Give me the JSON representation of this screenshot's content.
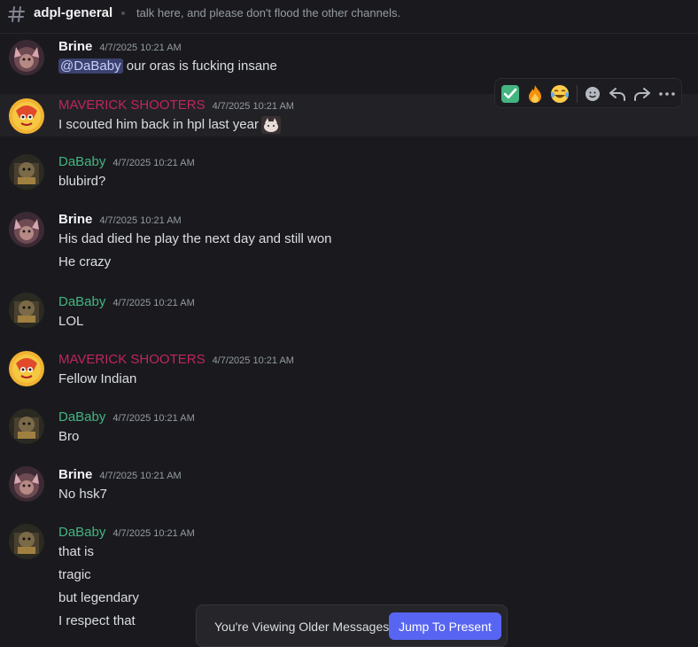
{
  "header": {
    "icon": "hash-icon",
    "channel_name": "adpl-general",
    "topic": "talk here, and please don't flood the other channels."
  },
  "messages": [
    {
      "author": "Brine",
      "timestamp": "4/7/2025 10:21 AM",
      "mention": "@DaBaby",
      "lines": [
        " our oras is fucking insane"
      ]
    },
    {
      "author": "MAVERICK SHOOTERS",
      "timestamp": "4/7/2025 10:21 AM",
      "lines": [
        "I scouted him back in hpl last year"
      ],
      "inline_emoji": "cat-emoji"
    },
    {
      "author": "DaBaby",
      "timestamp": "4/7/2025 10:21 AM",
      "lines": [
        "blubird?"
      ]
    },
    {
      "author": "Brine",
      "timestamp": "4/7/2025 10:21 AM",
      "lines": [
        "His dad died he play the next day and still won",
        "He crazy"
      ]
    },
    {
      "author": "DaBaby",
      "timestamp": "4/7/2025 10:21 AM",
      "lines": [
        "LOL"
      ]
    },
    {
      "author": "MAVERICK SHOOTERS",
      "timestamp": "4/7/2025 10:21 AM",
      "lines": [
        "Fellow Indian"
      ]
    },
    {
      "author": "DaBaby",
      "timestamp": "4/7/2025 10:21 AM",
      "lines": [
        "Bro"
      ]
    },
    {
      "author": "Brine",
      "timestamp": "4/7/2025 10:21 AM",
      "lines": [
        "No hsk7"
      ]
    },
    {
      "author": "DaBaby",
      "timestamp": "4/7/2025 10:21 AM",
      "lines": [
        "that is",
        "tragic",
        "but legendary",
        "I respect that"
      ]
    }
  ],
  "toolbar": {
    "quick_reactions": [
      "white-check-mark-emoji",
      "fire-emoji",
      "joy-emoji"
    ],
    "actions": [
      "add-reaction-icon",
      "reply-icon",
      "forward-icon",
      "more-icon"
    ]
  },
  "banner": {
    "text": "You're Viewing Older Messages",
    "button_label": "Jump To Present"
  },
  "colors": {
    "background": "#1a1a1e",
    "hover_background": "#222226",
    "brine_name": "#f2f3f5",
    "dababy_name": "#43b581",
    "maverick_name": "#c0255e",
    "accent": "#5865f2",
    "mention_bg": "#3c4270"
  }
}
